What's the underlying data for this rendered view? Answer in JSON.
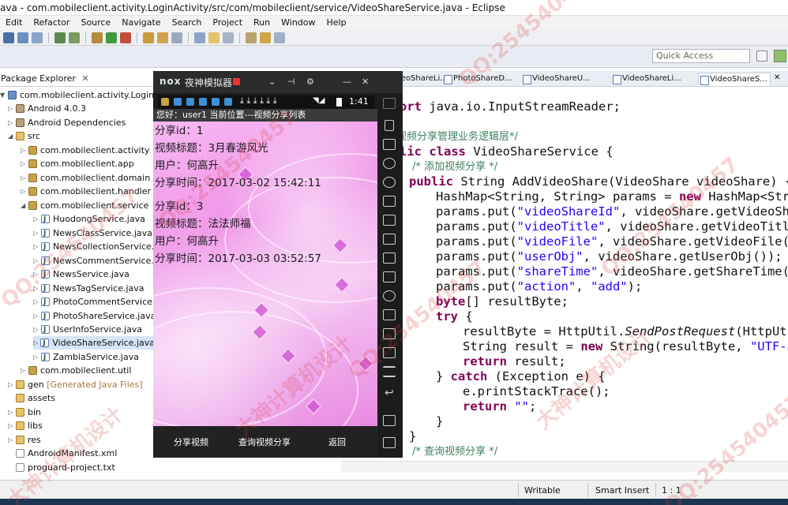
{
  "window": {
    "title": "ava - com.mobileclient.activity.LoginActivity/src/com/mobileclient/service/VideoShareService.java - Eclipse"
  },
  "menu": [
    "Edit",
    "Refactor",
    "Source",
    "Navigate",
    "Search",
    "Project",
    "Run",
    "Window",
    "Help"
  ],
  "quick_access": {
    "placeholder": "Quick Access"
  },
  "package_explorer": {
    "tab_label": "Package Explorer",
    "items": [
      {
        "label": "com.mobileclient.activity.LoginActivity",
        "icon": "project-icon"
      },
      {
        "label": "Android 4.0.3",
        "icon": "library-icon"
      },
      {
        "label": "Android Dependencies",
        "icon": "library-icon"
      },
      {
        "label": "src",
        "icon": "folder-icon"
      },
      {
        "label": "com.mobileclient.activity",
        "icon": "package-icon"
      },
      {
        "label": "com.mobileclient.app",
        "icon": "package-icon"
      },
      {
        "label": "com.mobileclient.domain",
        "icon": "package-icon"
      },
      {
        "label": "com.mobileclient.handler",
        "icon": "package-icon"
      },
      {
        "label": "com.mobileclient.service",
        "icon": "package-icon"
      },
      {
        "label": "HuodongService.java",
        "icon": "java-file-icon"
      },
      {
        "label": "NewsClassService.java",
        "icon": "java-file-icon"
      },
      {
        "label": "NewsCollectionService.ja",
        "icon": "java-file-icon"
      },
      {
        "label": "NewsCommentService.ja",
        "icon": "java-file-icon"
      },
      {
        "label": "NewsService.java",
        "icon": "java-file-icon"
      },
      {
        "label": "NewsTagService.java",
        "icon": "java-file-icon"
      },
      {
        "label": "PhotoCommentService.ja",
        "icon": "java-file-icon"
      },
      {
        "label": "PhotoShareService.java",
        "icon": "java-file-icon"
      },
      {
        "label": "UserInfoService.java",
        "icon": "java-file-icon"
      },
      {
        "label": "VideoShareService.java",
        "icon": "java-file-icon"
      },
      {
        "label": "ZambiaService.java",
        "icon": "java-file-icon"
      },
      {
        "label": "com.mobileclient.util",
        "icon": "package-icon"
      },
      {
        "label": "gen",
        "suffix": "[Generated Java Files]",
        "icon": "folder-icon"
      },
      {
        "label": "assets",
        "icon": "folder-icon"
      },
      {
        "label": "bin",
        "icon": "folder-icon"
      },
      {
        "label": "libs",
        "icon": "folder-icon"
      },
      {
        "label": "res",
        "icon": "folder-icon"
      },
      {
        "label": "AndroidManifest.xml",
        "icon": "file-icon"
      },
      {
        "label": "proguard-project.txt",
        "icon": "file-icon"
      }
    ]
  },
  "editor": {
    "tabs": [
      "VideoShareLi...",
      "PhotoShareD...",
      "VideoShareU...",
      "VideoShareLi...",
      "VideoShareS..."
    ],
    "lines": [
      "ort java.io.InputStreamReader;",
      "",
      "视频分享管理业务逻辑层*/",
      "lic class VideoShareService {",
      " /* 添加视频分享 */",
      "  public String AddVideoShare(VideoShare videoShare) {",
      "     HashMap<String, String> params = new HashMap<String,",
      "     params.put(\"videoShareId\", videoShare.getVideoShareI",
      "     params.put(\"videoTitle\", videoShare.getVideoTitle()",
      "     params.put(\"videoFile\", videoShare.getVideoFile());",
      "     params.put(\"userObj\", videoShare.getUserObj());",
      "     params.put(\"shareTime\", videoShare.getShareTime());",
      "     params.put(\"action\", \"add\");",
      "     byte[] resultByte;",
      "     try {",
      "        resultByte = HttpUtil.SendPostRequest(HttpUtil.",
      "        String result = new String(resultByte, \"UTF-8\");",
      "        return result;",
      "     } catch (Exception e) {",
      "        e.printStackTrace();",
      "        return \"\";",
      "     }",
      "  }",
      " /* 查询视频分享 */"
    ]
  },
  "status": {
    "mode": "Writable",
    "insert": "Smart Insert",
    "position": "1 : 1"
  },
  "nox": {
    "logo": "nox",
    "title": "夜神模拟器",
    "time": "1:41",
    "app_title": "您好：user1  当前位置---视频分享列表",
    "records": [
      {
        "id": "分享id：1",
        "title": "视频标题：3月春游风光",
        "user": "用户：何高升",
        "time": "分享时间：2017-03-02 15:42:11"
      },
      {
        "id": "分享id：3",
        "title": "视频标题：法法师福",
        "user": "用户：何高升",
        "time": "分享时间：2017-03-03 03:52:57"
      }
    ],
    "buttons": [
      "分享视频",
      "查询视频分享",
      "返回"
    ]
  },
  "watermark": {
    "qq": "QQ:254540457",
    "cn": "大神计算机设计"
  },
  "colors": {
    "keyword": "#7f0055",
    "string": "#2a00ff",
    "comment": "#3f7f5f",
    "accent": "#d14fd3"
  }
}
